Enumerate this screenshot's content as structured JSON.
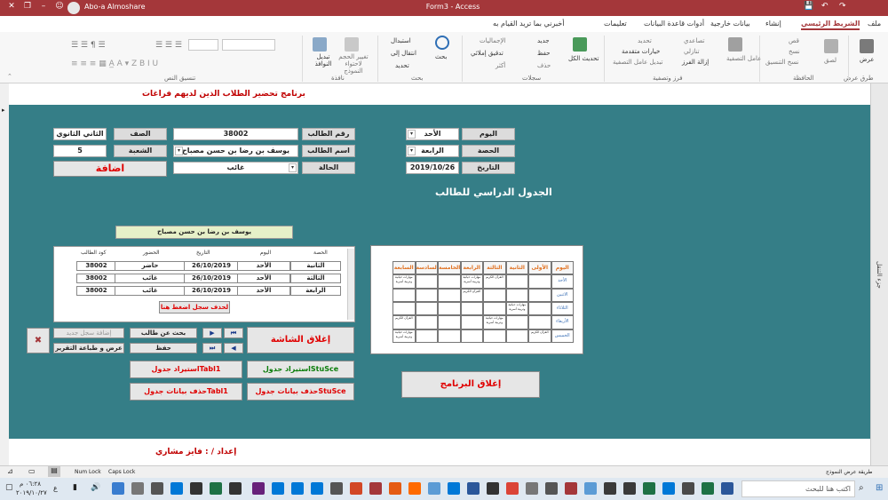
{
  "titlebar": {
    "title": "Form3  -  Access",
    "user": "Abo-a Almoshare"
  },
  "tabs": [
    {
      "label": "ملف"
    },
    {
      "label": "الشريط الرئيسي",
      "active": true
    },
    {
      "label": "إنشاء"
    },
    {
      "label": "بيانات خارجية"
    },
    {
      "label": "أدوات قاعدة البيانات"
    },
    {
      "label": "تعليمات"
    },
    {
      "label": "أخبرني بما تريد القيام به"
    }
  ],
  "ribbon": {
    "groups": [
      "طرق عرض",
      "الحافظة",
      "فرز وتصفية",
      "سجلات",
      "بحث",
      "نافذة",
      "تنسيق النص"
    ],
    "views": "عرض",
    "paste": "لصق",
    "cut": "قص",
    "copy": "نسخ",
    "format_painter": "نسخ التنسيق",
    "filter": "عامل التصفية",
    "ascending": "تصاعدي",
    "descending": "تنازلي",
    "remove_sort": "إزالة الفرز",
    "selection": "تحديد",
    "advanced": "خيارات متقدمة",
    "toggle_filter": "تبديل عامل التصفية",
    "refresh_all": "تحديث الكل",
    "new": "جديد",
    "save": "حفظ",
    "delete": "حذف",
    "totals": "الإجماليات",
    "spelling": "تدقيق إملائي",
    "more": "أكثر",
    "find": "بحث",
    "replace": "استبدال",
    "goto": "انتقال إلى",
    "select": "تحديد",
    "size_to_fit": "تغيير الحجم لاحتواء النموذج",
    "switch_windows": "تبديل النوافذ"
  },
  "form": {
    "header_title": "برنامج تحضير الطلاب الذين لديهم فراغات",
    "labels": {
      "day": "اليوم",
      "period": "الحصة",
      "date": "التاريخ",
      "student_no": "رقم الطالب",
      "student_name": "اسم الطالب",
      "status": "الحالة",
      "grade": "الصف",
      "section": "الشعبة"
    },
    "values": {
      "day": "الأحد",
      "period": "الرابعة",
      "date": "2019/10/26",
      "student_no": "38002",
      "student_name": "يوسف بن رضا بن حسن مصباح",
      "status": "غائب",
      "grade": "الثاني الثانوي",
      "section": "5"
    },
    "add_button": "اضافة",
    "timetable_title": "الجدول الدراسي للطالب",
    "name_banner": "يوسف بن رضا بن حسن مصباح",
    "subform": {
      "headers": [
        "كود الطالب",
        "الحضور",
        "التاريخ",
        "اليوم",
        "الحصة"
      ],
      "rows": [
        [
          "38002",
          "حاضر",
          "26/10/2019",
          "الأحد",
          "الثانية"
        ],
        [
          "38002",
          "غائب",
          "26/10/2019",
          "الأحد",
          "الثالثة"
        ],
        [
          "38002",
          "غائب",
          "26/10/2019",
          "الأحد",
          "الرابعة"
        ]
      ],
      "delete_button": "لحذف سجل اضغط هنا"
    },
    "buttons": {
      "add_new": "إضافة سجل جديد",
      "search_student": "بحث عن طالب",
      "save": "حفظ",
      "print_report": "عرض و طباعة التقرير",
      "close_screen": "إغلاق الشاشة",
      "import_tabl1": "استيراد جدولTabl1",
      "import_stusce": "استيراد جدولStuSce",
      "delete_tabl1": "حذف بيانات جدولTabl1",
      "delete_stusce": "حذف بيانات جدولStuSce",
      "close_program": "إغلاق البرنامج",
      "nav_first": "⏮",
      "nav_prev": "◀",
      "nav_next": "▶",
      "nav_last": "⏭",
      "exit_icon": "✖"
    },
    "timetable": {
      "headers": [
        "اليوم",
        "الأولى",
        "الثانية",
        "الثالثة",
        "الرابعة",
        "الخامسة",
        "السادسة",
        "السابعة"
      ],
      "days": [
        "الأحد",
        "الاثنين",
        "الثلاثاء",
        "الأربعاء",
        "الخميس"
      ],
      "entries": [
        {
          "row": 0,
          "col": 3,
          "text": "القرآن الكريم"
        },
        {
          "row": 0,
          "col": 4,
          "text": "مهارات حياتية وتربية أسرية"
        },
        {
          "row": 0,
          "col": 7,
          "text": "مهارات حياتية وتربية أسرية"
        },
        {
          "row": 1,
          "col": 4,
          "text": "القرآن الكريم"
        },
        {
          "row": 2,
          "col": 2,
          "text": "مهارات حياتية وتربية أسرية"
        },
        {
          "row": 3,
          "col": 3,
          "text": "مهارات حياتية وتربية أسرية"
        },
        {
          "row": 3,
          "col": 7,
          "text": "القرآن الكريم"
        },
        {
          "row": 4,
          "col": 1,
          "text": "القرآن الكريم"
        },
        {
          "row": 4,
          "col": 7,
          "text": "مهارات حياتية وتربية أسرية"
        }
      ]
    },
    "footer_text": "إعداد / : فايز مشاري"
  },
  "nav_pane": {
    "label": "جزء التنقل"
  },
  "statusbar": {
    "view": "طريقة عرض النموذج",
    "num_lock": "Num Lock",
    "caps_lock": "Caps Lock"
  },
  "taskbar": {
    "search": "اكتب هنا للبحث",
    "time": "٠٦:٢٨ م",
    "date": "٢٠١٩/١٠/٢٧",
    "lang": "ع"
  },
  "colors": {
    "access_red": "#a4373a",
    "form_teal": "#357e87",
    "alert_red": "#e00000",
    "ok_green": "#0a7d0a"
  }
}
